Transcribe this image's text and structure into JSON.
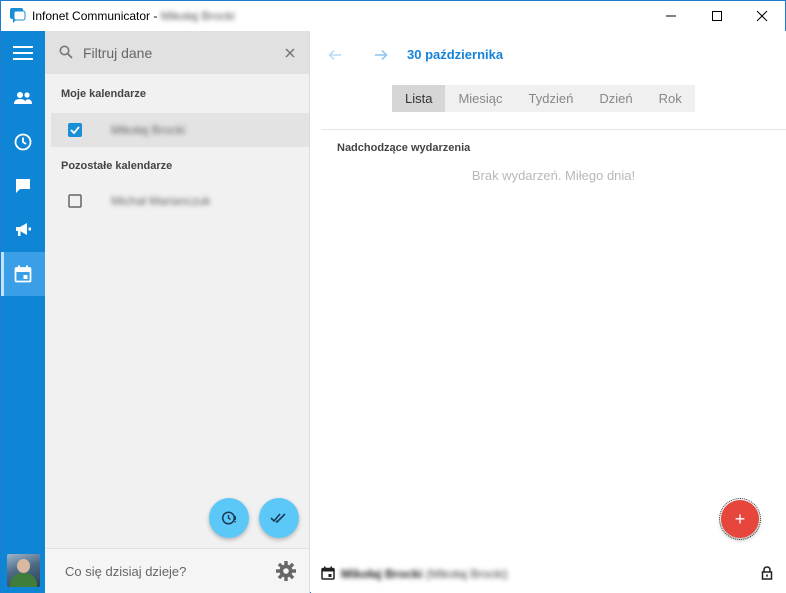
{
  "window": {
    "app_name": "Infonet Communicator -",
    "user_name": "Mikołaj Brocki"
  },
  "rail": {
    "items": [
      {
        "icon": "menu-icon"
      },
      {
        "icon": "contacts-icon"
      },
      {
        "icon": "history-icon"
      },
      {
        "icon": "chat-icon"
      },
      {
        "icon": "announcements-icon"
      },
      {
        "icon": "calendar-icon",
        "active": true
      }
    ]
  },
  "panel": {
    "search_placeholder": "Filtruj dane",
    "my_calendars_header": "Moje kalendarze",
    "my_calendars": [
      {
        "name": "Mikołaj Brocki",
        "checked": true
      }
    ],
    "other_calendars_header": "Pozostałe kalendarze",
    "other_calendars": [
      {
        "name": "Michał Marianczuk",
        "checked": false
      }
    ],
    "status_placeholder": "Co się dzisiaj dzieje?"
  },
  "main": {
    "date_title": "30 października",
    "tabs": [
      {
        "label": "Lista",
        "active": true
      },
      {
        "label": "Miesiąc"
      },
      {
        "label": "Tydzień"
      },
      {
        "label": "Dzień"
      },
      {
        "label": "Rok"
      }
    ],
    "upcoming_header": "Nadchodzące wydarzenia",
    "empty_message": "Brak wydarzeń. Miłego dnia!",
    "add_label": "+",
    "footer_user_name": "Mikołaj Brocki",
    "footer_user_sub": "(Mikołaj Brocki)"
  },
  "colors": {
    "rail": "#0f86d5",
    "accent": "#1783d8",
    "fab_add": "#e7463c",
    "fab_small": "#5cc8f8"
  }
}
